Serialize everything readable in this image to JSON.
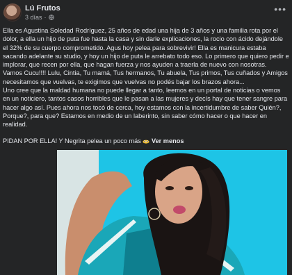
{
  "post": {
    "author": "Lú Frutos",
    "time": "3 días",
    "separator": "·",
    "paragraph1": "Ella es Agustina Soledad Rodríguez, 25 años de edad una hija de 3 años y una familia rota por el dolor, a ella un hijo de puta fue hasta la casa y sin darle explicaciones, la rocio con ácido dejándole el 32% de su cuerpo comprometido. Agus hoy pelea para sobrevivir! Ella es manicura estaba sacando adelante su studio, y hoy un hijo de puta le arrebato todo eso. Lo primero que quiero pedir e implorar, que recen por ella, que hagan fuerza y nos ayuden a traerla de nuevo con nosotras.",
    "paragraph2": "Vamos Cucu!!!! Lulu, Cintia, Tu mamá, Tus hermanos, Tu abuela, Tus primos, Tus cuñados y Amigos necesitamos que vuelvas, te exigimos que vuelvas no podés bajar los brazos ahora...",
    "paragraph3": "Uno cree que la maldad humana no puede llegar a tanto, leemos en un portal de noticias o vemos en un noticiero, tantos casos horribles que le pasan a las mujeres y decís hay que tener sangre para hacer algo así. Pues ahora nos tocó de cerca, hoy estamos con la incertidumbre de saber Quién?, Porque?, para que? Estamos en medio de un laberinto, sin saber cómo hacer o que hacer en realidad.",
    "paragraph4": "PIDAN POR ELLA! Y Negrita pelea un poco más",
    "see_more": "Ver menos"
  },
  "icons": {
    "globe": "globe-icon",
    "more": "more-options-icon",
    "emoji": "pleading-eyes-emoji"
  },
  "colors": {
    "background": "#242526",
    "text": "#e4e6eb",
    "meta": "#b0b3b8",
    "photo_bg": "#1ec4e6"
  }
}
